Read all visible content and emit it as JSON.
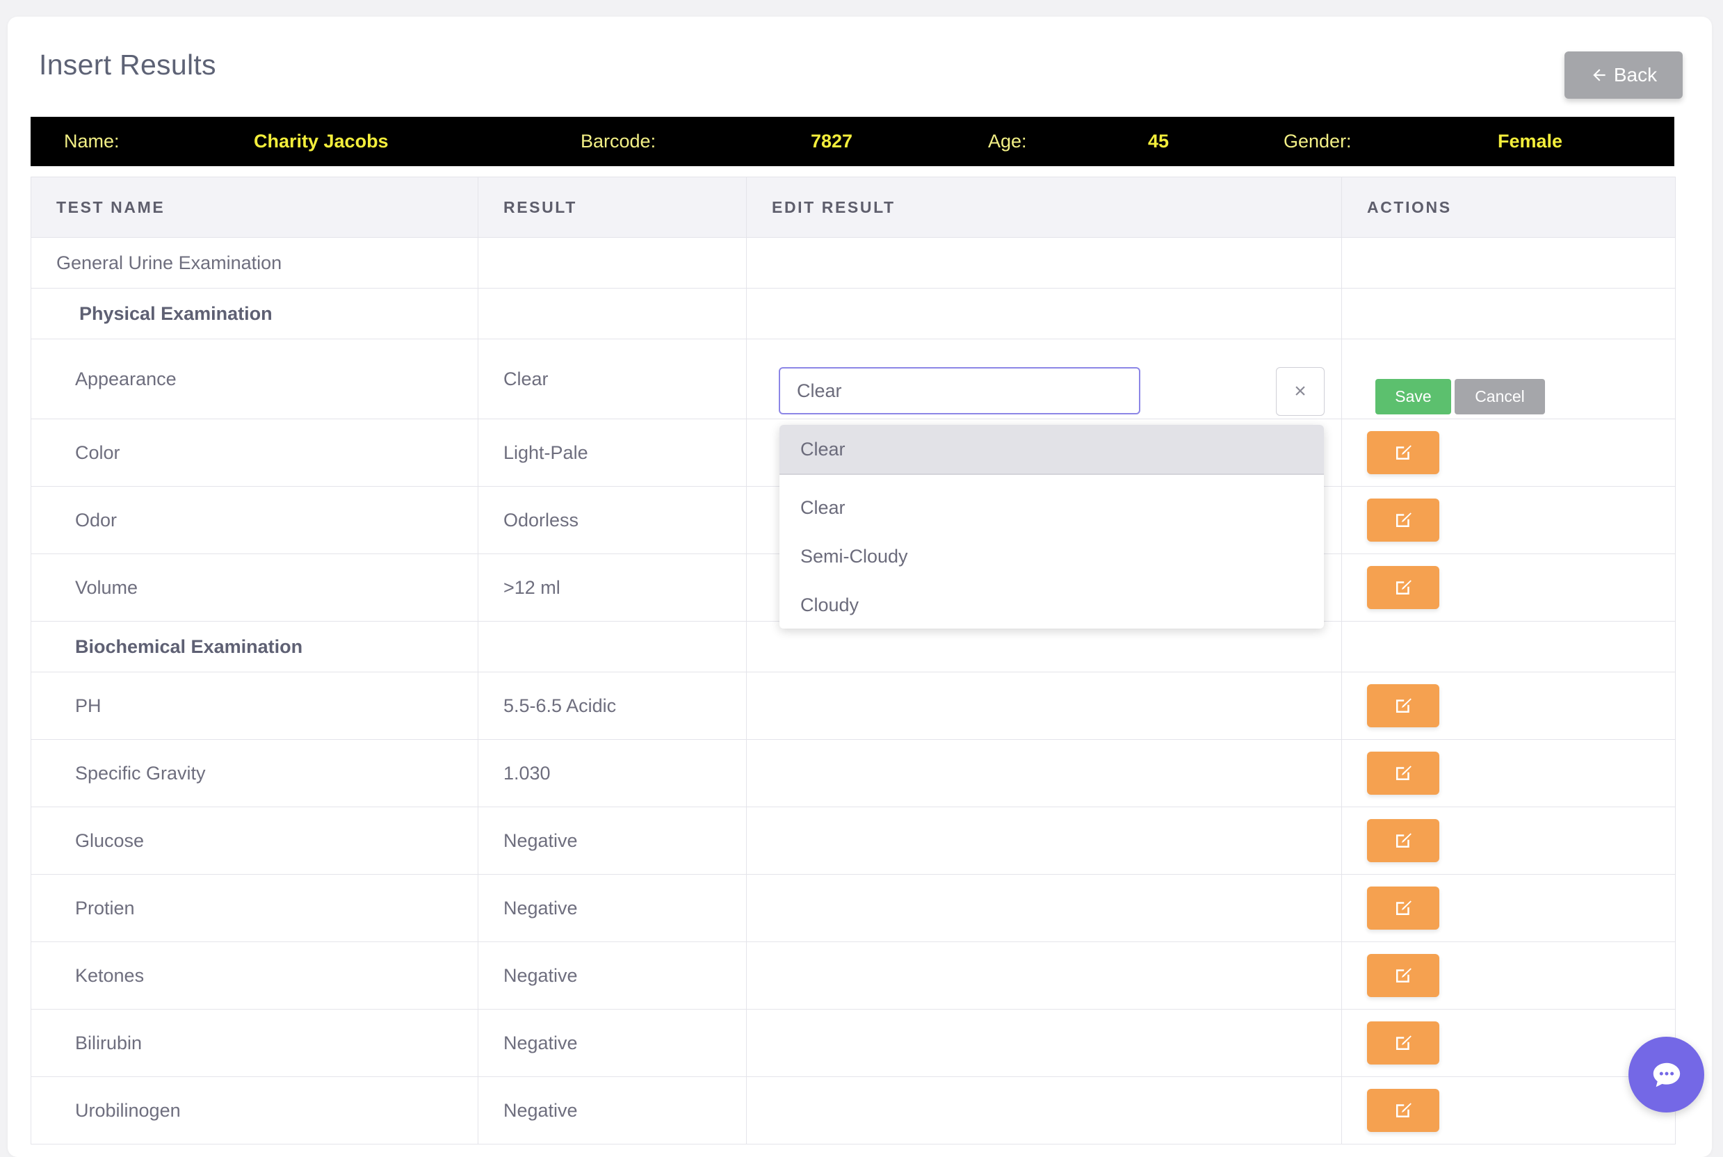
{
  "page": {
    "title": "Insert Results",
    "back_label": "Back"
  },
  "patient": {
    "name_label": "Name:",
    "name": "Charity Jacobs",
    "barcode_label": "Barcode:",
    "barcode": "7827",
    "age_label": "Age:",
    "age": "45",
    "gender_label": "Gender:",
    "gender": "Female"
  },
  "table": {
    "headers": [
      "TEST NAME",
      "RESULT",
      "EDIT RESULT",
      "ACTIONS"
    ],
    "rows": [
      {
        "name": "General Urine Examination",
        "result": ""
      },
      {
        "name": "Physical Examination",
        "result": ""
      },
      {
        "name": "Appearance",
        "result": "Clear"
      },
      {
        "name": "Color",
        "result": "Light-Pale"
      },
      {
        "name": "Odor",
        "result": "Odorless"
      },
      {
        "name": "Volume",
        "result": ">12 ml"
      },
      {
        "name": "Biochemical Examination",
        "result": ""
      },
      {
        "name": "PH",
        "result": "5.5-6.5 Acidic"
      },
      {
        "name": "Specific Gravity",
        "result": "1.030"
      },
      {
        "name": "Glucose",
        "result": "Negative"
      },
      {
        "name": "Protien",
        "result": "Negative"
      },
      {
        "name": "Ketones",
        "result": "Negative"
      },
      {
        "name": "Bilirubin",
        "result": "Negative"
      },
      {
        "name": "Urobilinogen",
        "result": "Negative"
      }
    ]
  },
  "editor": {
    "value": "Clear",
    "save_label": "Save",
    "cancel_label": "Cancel",
    "clear_label": "×",
    "selected": "Clear",
    "options": [
      "Clear",
      "Semi-Cloudy",
      "Cloudy"
    ]
  },
  "icons": {
    "back": "arrow-left-icon",
    "edit": "edit-icon",
    "clear": "close-icon",
    "chat": "chat-icon"
  },
  "colors": {
    "accent": "#f5a150",
    "save": "#5cc06e",
    "neutral": "#a5a6aa",
    "highlight": "#f3ee3b",
    "chat": "#7468e6"
  }
}
